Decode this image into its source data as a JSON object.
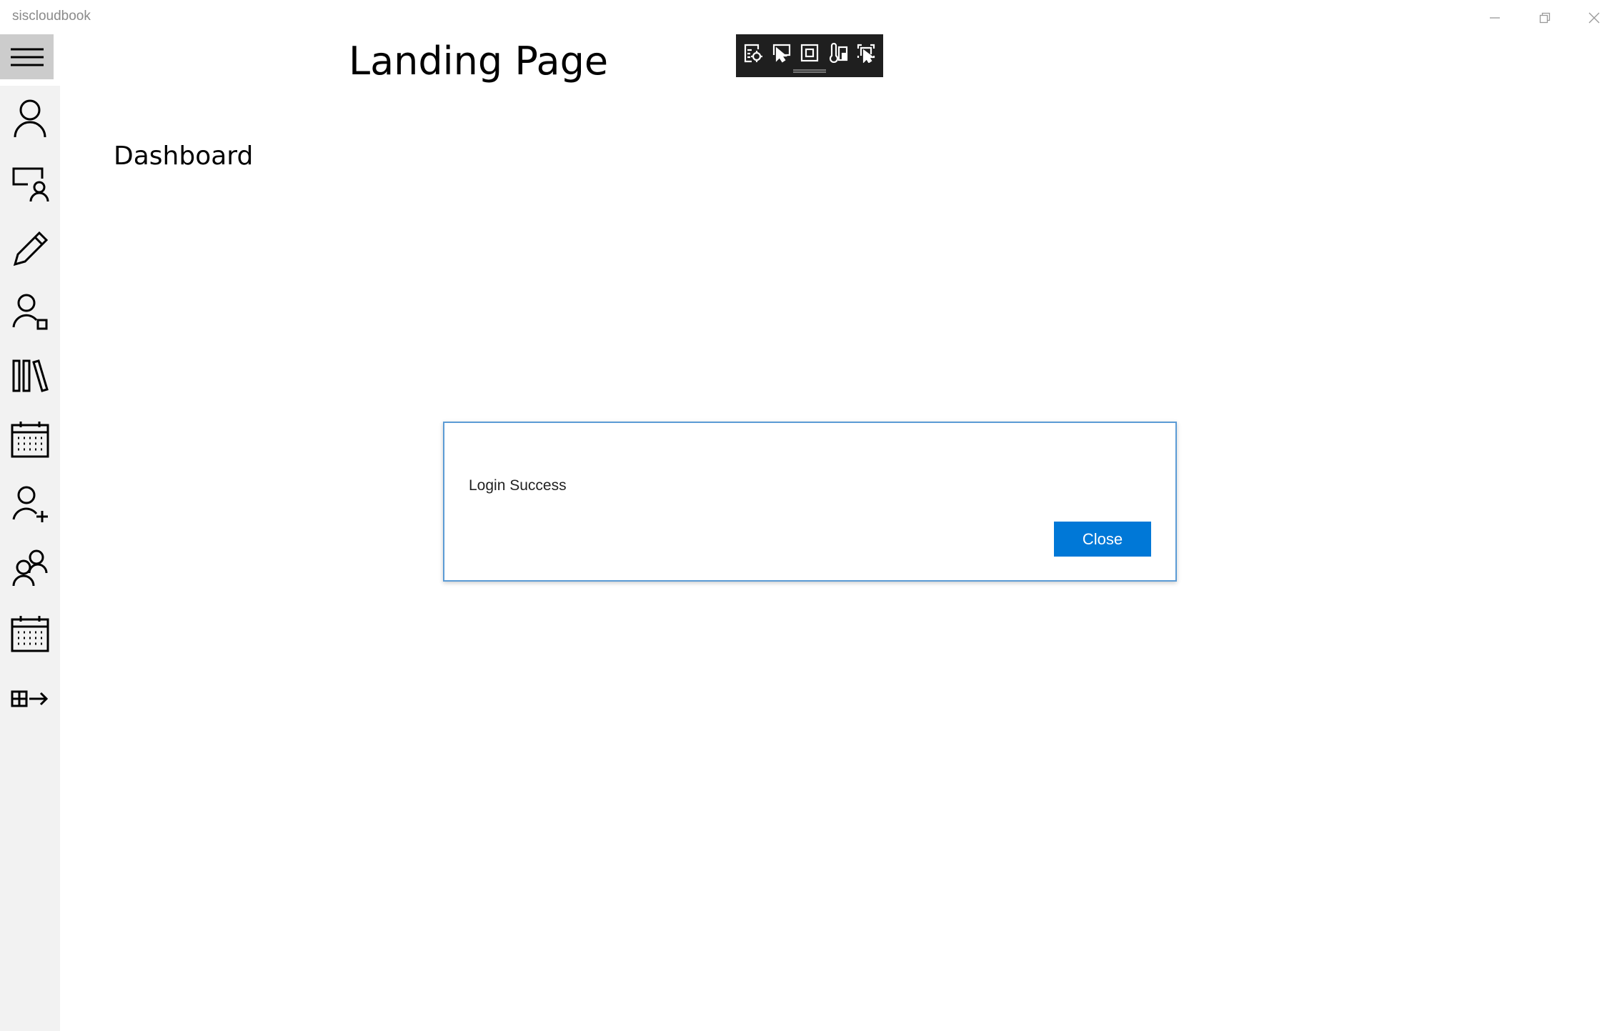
{
  "window": {
    "app_title": "siscloudbook",
    "minimize_icon": "minimize-icon",
    "restore_icon": "restore-icon",
    "close_icon": "close-icon"
  },
  "header": {
    "title": "Landing Page"
  },
  "main": {
    "section_title": "Dashboard"
  },
  "sidebar": {
    "items": [
      "person-icon",
      "presenter-icon",
      "pencil-icon",
      "contact-icon",
      "library-icon",
      "calendar-icon",
      "add-person-icon",
      "people-icon",
      "calendar-icon",
      "apps-arrow-icon"
    ]
  },
  "debug_toolbar": {
    "tools": [
      "live-visual-tree-icon",
      "select-element-icon",
      "display-layout-adorners-icon",
      "track-focus-icon",
      "preview-selection-icon"
    ]
  },
  "dialog": {
    "message": "Login Success",
    "close_label": "Close",
    "accent": "#0078d7"
  }
}
